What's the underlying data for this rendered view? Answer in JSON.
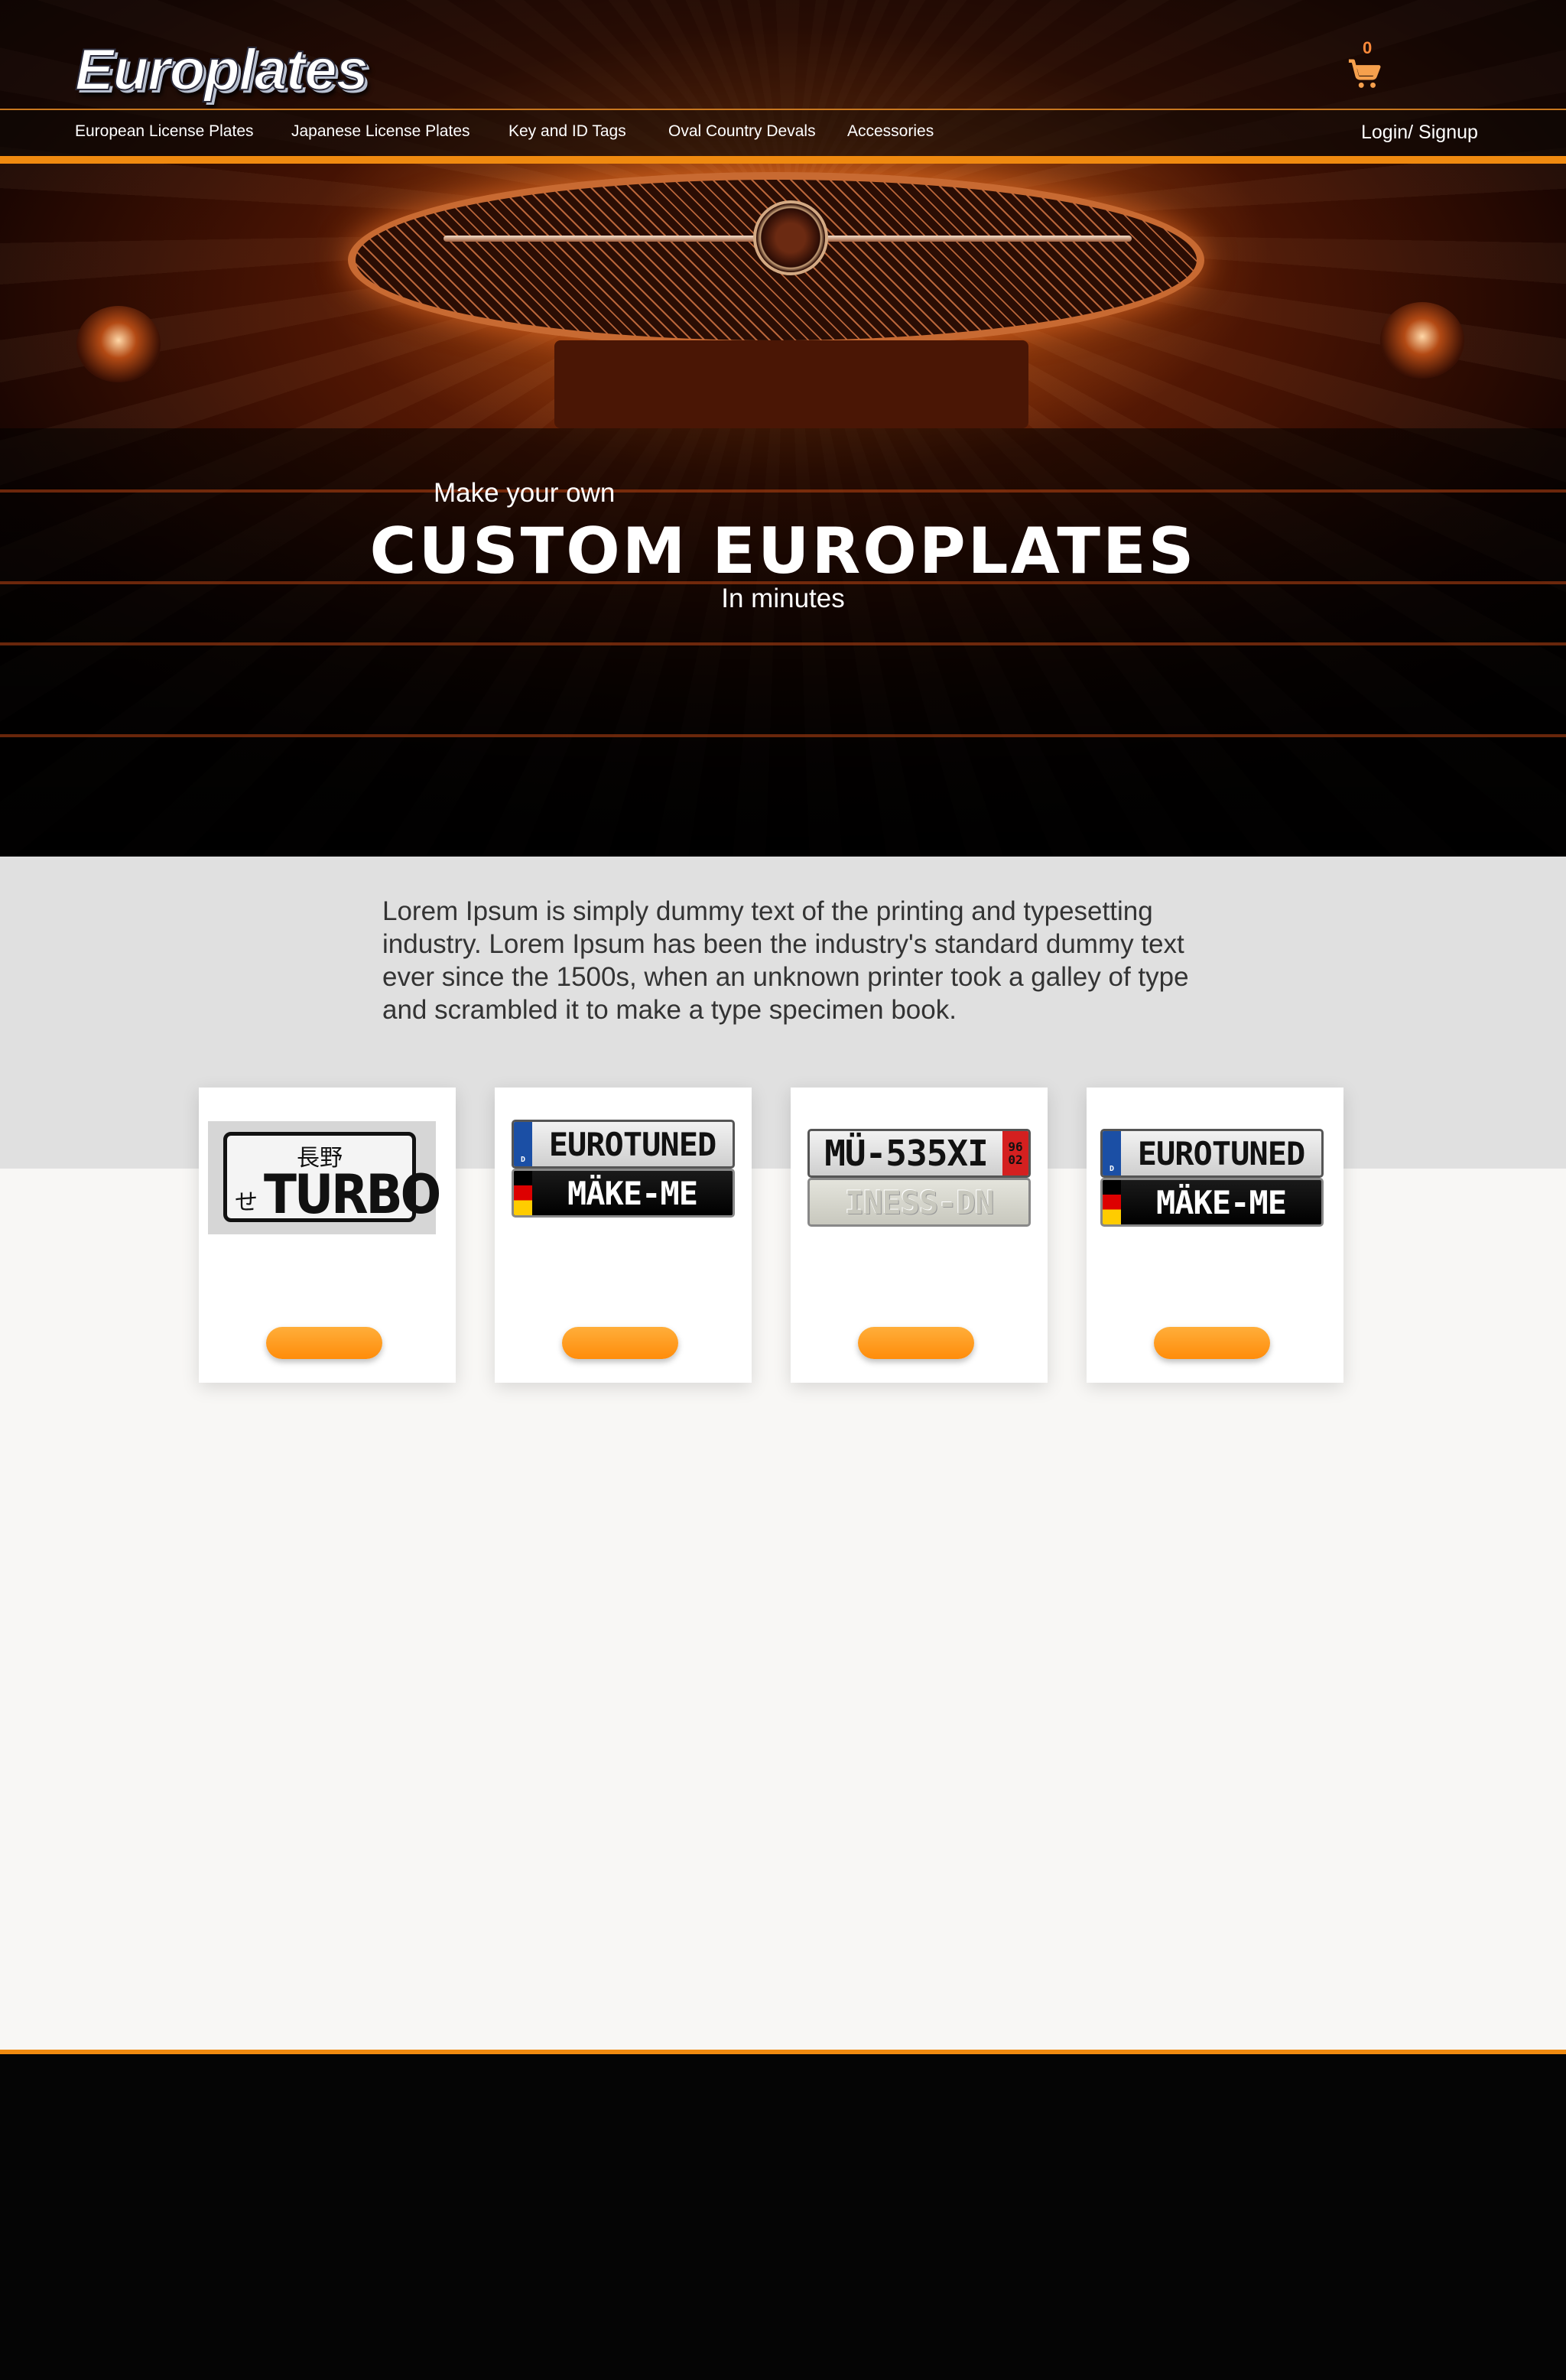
{
  "header": {
    "logo_text": "Europlates",
    "cart_count": "0",
    "login_label": "Login/ Signup"
  },
  "nav": {
    "items": [
      {
        "label": "European License Plates"
      },
      {
        "label": "Japanese License Plates"
      },
      {
        "label": "Key and ID Tags"
      },
      {
        "label": "Oval Country Devals"
      },
      {
        "label": "Accessories"
      }
    ]
  },
  "hero": {
    "line1": "Make your own",
    "headline": "CUSTOM EUROPLATES",
    "line3": "In minutes"
  },
  "intro": {
    "text": "Lorem Ipsum is simply dummy text of the printing and typesetting industry. Lorem Ipsum has been the industry's standard dummy text ever since the 1500s, when an unknown printer took a galley of type and scrambled it to make a type specimen book."
  },
  "products": [
    {
      "plate_top": "長野",
      "plate_kana": "せ",
      "plate_main": "TURBO"
    },
    {
      "plate_1": "EUROTUNED",
      "plate_2": "MÄKE-ME",
      "eu_code": "D"
    },
    {
      "plate_1": "MÜ-535XI",
      "plate_1_side": "96 02",
      "plate_2": "INESS-DN"
    },
    {
      "plate_1": "EUROTUNED",
      "plate_2": "MÄKE-ME",
      "eu_code": "D"
    }
  ],
  "colors": {
    "accent": "#f08a10",
    "nav_bg": "#1a0e08",
    "band_bg": "#e0e0e0",
    "footer_bg": "#050505"
  }
}
